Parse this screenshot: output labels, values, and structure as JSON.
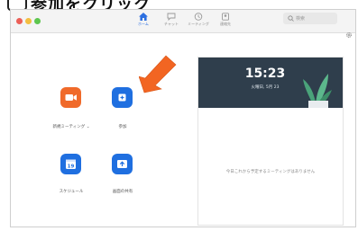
{
  "header": {
    "text": "参加をクリック"
  },
  "nav": {
    "tabs": [
      {
        "label": "ホーム"
      },
      {
        "label": "チャット"
      },
      {
        "label": "ミーティング"
      },
      {
        "label": "連絡先"
      }
    ]
  },
  "search": {
    "placeholder": "検索"
  },
  "actions": {
    "new_meeting": "新規ミーティング",
    "new_meeting_chevron": "⌄",
    "join": "参加",
    "schedule": "スケジュール",
    "share_screen": "画面の共有",
    "calendar_day": "19"
  },
  "panel": {
    "time": "15:23",
    "date": "火曜日, 5月 23",
    "empty_message": "今日これから予定するミーティングはありません"
  },
  "colors": {
    "orange": "#f06a2a",
    "blue": "#1f6fe0",
    "arrow": "#f26522",
    "banner": "#2f3e4c"
  }
}
